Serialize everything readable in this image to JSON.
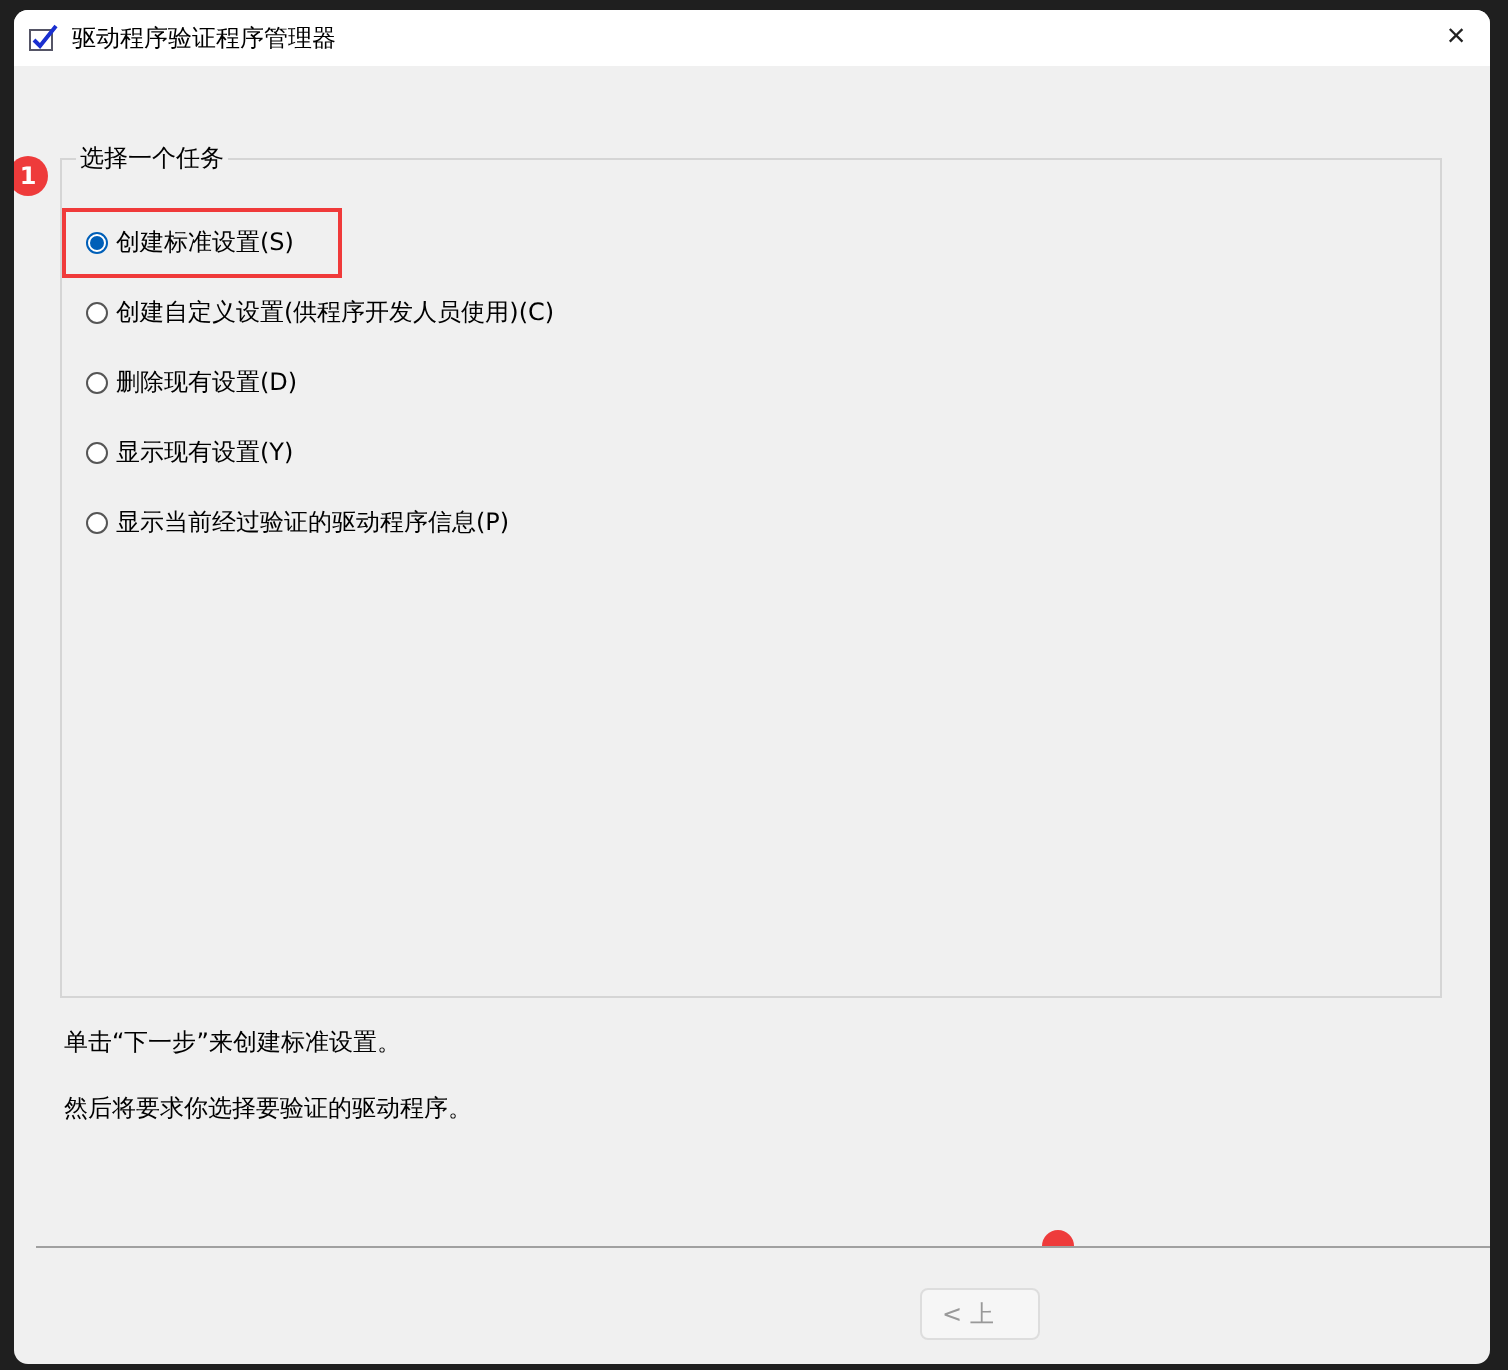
{
  "window": {
    "title": "驱动程序验证程序管理器",
    "close": "×"
  },
  "task_group": {
    "legend": "选择一个任务",
    "step_badge": "1",
    "options": [
      {
        "label": "创建标准设置(S)",
        "selected": true,
        "highlighted": true
      },
      {
        "label": "创建自定义设置(供程序开发人员使用)(C)",
        "selected": false,
        "highlighted": false
      },
      {
        "label": "删除现有设置(D)",
        "selected": false,
        "highlighted": false
      },
      {
        "label": "显示现有设置(Y)",
        "selected": false,
        "highlighted": false
      },
      {
        "label": "显示当前经过验证的驱动程序信息(P)",
        "selected": false,
        "highlighted": false
      }
    ]
  },
  "description": [
    "单击“下一步”来创建标准设置。",
    "然后将要求你选择要验证的驱动程序。"
  ],
  "buttons": [
    {
      "label": "< 上",
      "disabled": true
    }
  ]
}
